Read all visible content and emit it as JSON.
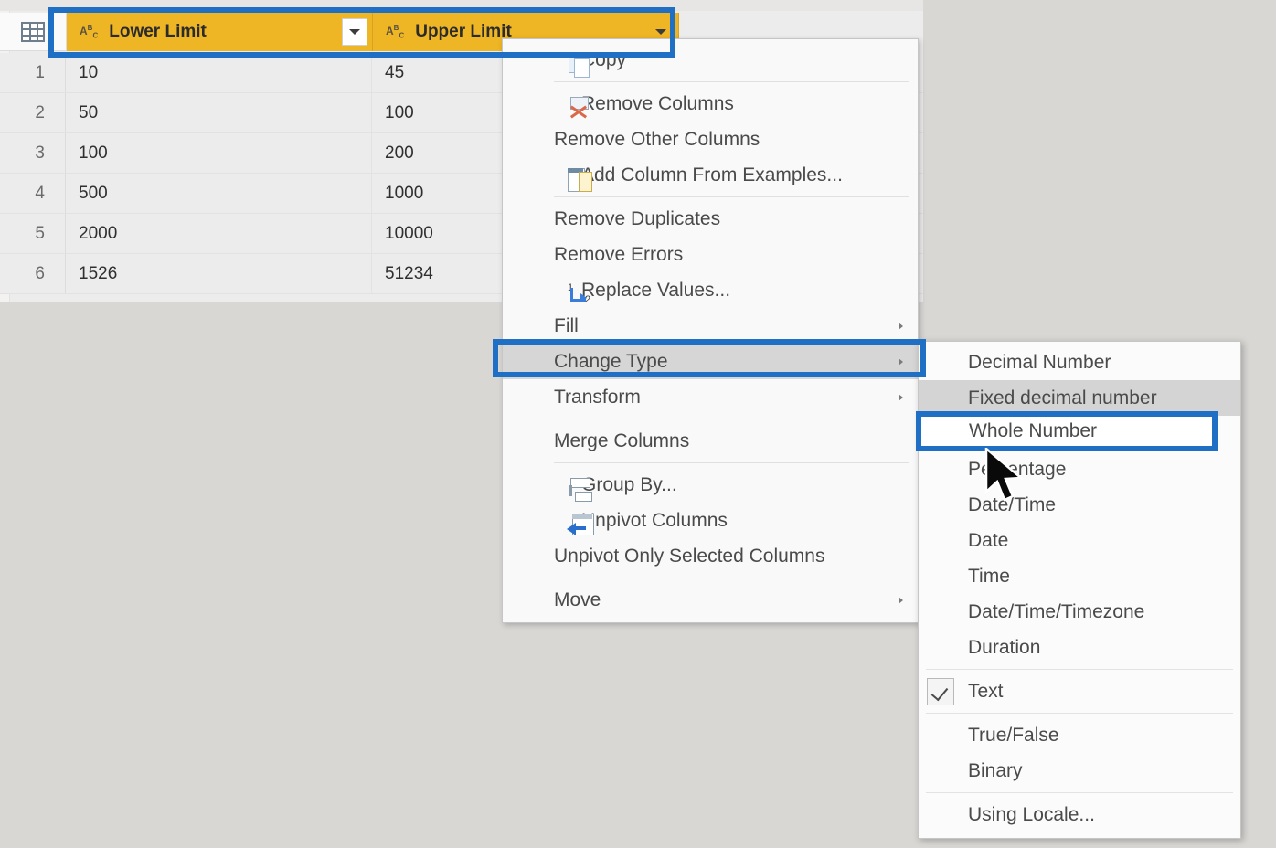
{
  "grid": {
    "row_header_icon": "table-icon",
    "columns": [
      {
        "name": "Lower Limit",
        "type_icon": "abc-text-type-icon"
      },
      {
        "name": "Upper Limit",
        "type_icon": "abc-text-type-icon"
      }
    ],
    "rows": [
      {
        "num": "1",
        "lower": "10",
        "upper": "45"
      },
      {
        "num": "2",
        "lower": "50",
        "upper": "100"
      },
      {
        "num": "3",
        "lower": "100",
        "upper": "200"
      },
      {
        "num": "4",
        "lower": "500",
        "upper": "1000"
      },
      {
        "num": "5",
        "lower": "2000",
        "upper": "10000"
      },
      {
        "num": "6",
        "lower": "1526",
        "upper": "51234"
      }
    ]
  },
  "context_menu": {
    "items": [
      {
        "label": "Copy",
        "icon": "copy-icon",
        "submenu": false,
        "separator_after": true
      },
      {
        "label": "Remove Columns",
        "icon": "remove-columns-icon",
        "submenu": false,
        "separator_after": false
      },
      {
        "label": "Remove Other Columns",
        "icon": "none",
        "submenu": false,
        "separator_after": false
      },
      {
        "label": "Add Column From Examples...",
        "icon": "add-column-icon",
        "submenu": false,
        "separator_after": true
      },
      {
        "label": "Remove Duplicates",
        "icon": "none",
        "submenu": false,
        "separator_after": false
      },
      {
        "label": "Remove Errors",
        "icon": "none",
        "submenu": false,
        "separator_after": false
      },
      {
        "label": "Replace Values...",
        "icon": "replace-values-icon",
        "submenu": false,
        "separator_after": false
      },
      {
        "label": "Fill",
        "icon": "none",
        "submenu": true,
        "separator_after": false
      },
      {
        "label": "Change Type",
        "icon": "none",
        "submenu": true,
        "separator_after": false
      },
      {
        "label": "Transform",
        "icon": "none",
        "submenu": true,
        "separator_after": true
      },
      {
        "label": "Merge Columns",
        "icon": "none",
        "submenu": false,
        "separator_after": true
      },
      {
        "label": "Group By...",
        "icon": "group-by-icon",
        "submenu": false,
        "separator_after": false
      },
      {
        "label": "Unpivot Columns",
        "icon": "unpivot-icon",
        "submenu": false,
        "separator_after": false
      },
      {
        "label": "Unpivot Only Selected Columns",
        "icon": "none",
        "submenu": false,
        "separator_after": true
      },
      {
        "label": "Move",
        "icon": "none",
        "submenu": true,
        "separator_after": false
      }
    ],
    "hovered_item": "Change Type"
  },
  "type_submenu": {
    "items": [
      {
        "label": "Decimal Number",
        "checked": false,
        "highlighted": false
      },
      {
        "label": "Fixed decimal number",
        "checked": false,
        "highlighted": true
      },
      {
        "label": "Whole Number",
        "checked": false,
        "highlighted": false
      },
      {
        "label": "Percentage",
        "checked": false,
        "highlighted": false
      },
      {
        "label": "Date/Time",
        "checked": false,
        "highlighted": false
      },
      {
        "label": "Date",
        "checked": false,
        "highlighted": false
      },
      {
        "label": "Time",
        "checked": false,
        "highlighted": false
      },
      {
        "label": "Date/Time/Timezone",
        "checked": false,
        "highlighted": false
      },
      {
        "label": "Duration",
        "checked": false,
        "highlighted": false
      },
      {
        "label": "Text",
        "checked": true,
        "highlighted": false
      },
      {
        "label": "True/False",
        "checked": false,
        "highlighted": false
      },
      {
        "label": "Binary",
        "checked": false,
        "highlighted": false
      },
      {
        "label": "Using Locale...",
        "checked": false,
        "highlighted": false
      }
    ],
    "selected_label": "Whole Number",
    "checked_label": "Text"
  },
  "annotations": {
    "highlight_color": "#1f6fc4",
    "header_fill": "#eeb524",
    "boxes": [
      {
        "target": "column-headers"
      },
      {
        "target": "Change Type"
      },
      {
        "target": "Whole Number"
      }
    ]
  }
}
